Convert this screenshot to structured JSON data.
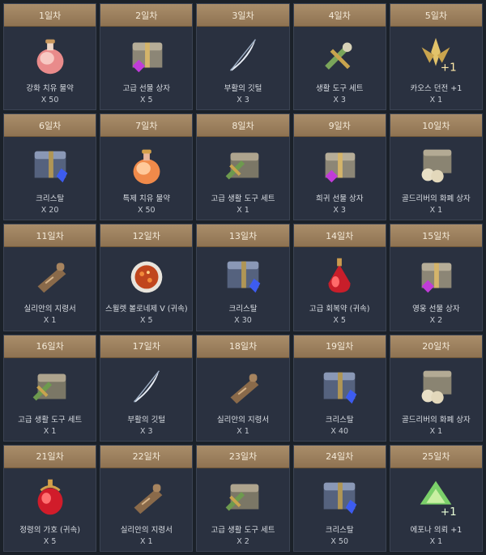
{
  "rewards": [
    {
      "day": "1일차",
      "name": "강화 치유 물약",
      "qty": "X 50",
      "icon": "pink-potion-icon"
    },
    {
      "day": "2일차",
      "name": "고급 선물 상자",
      "qty": "X 5",
      "icon": "gift-chest-icon"
    },
    {
      "day": "3일차",
      "name": "부활의 깃털",
      "qty": "X 3",
      "icon": "feather-icon"
    },
    {
      "day": "4일차",
      "name": "생활 도구 세트",
      "qty": "X 3",
      "icon": "tool-set-icon"
    },
    {
      "day": "5일차",
      "name": "카오스 던전 +1",
      "qty": "X 1",
      "icon": "chaos-dungeon-icon"
    },
    {
      "day": "6일차",
      "name": "크리스탈",
      "qty": "X 20",
      "icon": "crystal-chest-icon"
    },
    {
      "day": "7일차",
      "name": "특제 치유 물약",
      "qty": "X 50",
      "icon": "orange-potion-icon"
    },
    {
      "day": "8일차",
      "name": "고급 생활 도구 세트",
      "qty": "X 1",
      "icon": "tool-chest-icon"
    },
    {
      "day": "9일차",
      "name": "희귀 선물 상자",
      "qty": "X 3",
      "icon": "gift-chest-icon"
    },
    {
      "day": "10일차",
      "name": "골드리버의 화폐 상자",
      "qty": "X 1",
      "icon": "coin-chest-icon"
    },
    {
      "day": "11일차",
      "name": "실리안의 지령서",
      "qty": "X 1",
      "icon": "scroll-icon"
    },
    {
      "day": "12일차",
      "name": "스윌렛 볼로네제 V (귀속)",
      "qty": "X 5",
      "icon": "food-plate-icon"
    },
    {
      "day": "13일차",
      "name": "크리스탈",
      "qty": "X 30",
      "icon": "crystal-chest-icon"
    },
    {
      "day": "14일차",
      "name": "고급 회복약 (귀속)",
      "qty": "X 5",
      "icon": "red-potion-icon"
    },
    {
      "day": "15일차",
      "name": "영웅 선물 상자",
      "qty": "X 2",
      "icon": "gift-chest-icon"
    },
    {
      "day": "16일차",
      "name": "고급 생활 도구 세트",
      "qty": "X 1",
      "icon": "tool-chest-icon"
    },
    {
      "day": "17일차",
      "name": "부활의 깃털",
      "qty": "X 3",
      "icon": "feather-icon"
    },
    {
      "day": "18일차",
      "name": "실리안의 지령서",
      "qty": "X 1",
      "icon": "scroll-icon"
    },
    {
      "day": "19일차",
      "name": "크리스탈",
      "qty": "X 40",
      "icon": "crystal-chest-icon"
    },
    {
      "day": "20일차",
      "name": "골드리버의 화폐 상자",
      "qty": "X 1",
      "icon": "coin-chest-icon"
    },
    {
      "day": "21일차",
      "name": "정령의 가호 (귀속)",
      "qty": "X 5",
      "icon": "spirit-potion-icon"
    },
    {
      "day": "22일차",
      "name": "실리안의 지령서",
      "qty": "X 1",
      "icon": "scroll-icon"
    },
    {
      "day": "23일차",
      "name": "고급 생활 도구 세트",
      "qty": "X 2",
      "icon": "tool-chest-icon"
    },
    {
      "day": "24일차",
      "name": "크리스탈",
      "qty": "X 50",
      "icon": "crystal-chest-icon"
    },
    {
      "day": "25일차",
      "name": "에포나 의뢰 +1",
      "qty": "X 1",
      "icon": "epona-quest-icon"
    }
  ]
}
